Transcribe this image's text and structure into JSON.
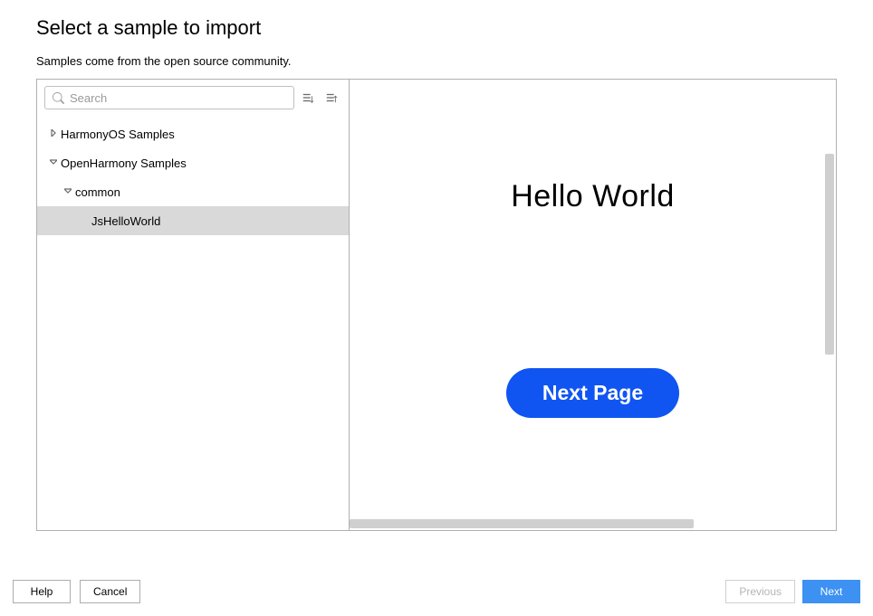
{
  "header": {
    "title": "Select a sample to import",
    "subtitle": "Samples come from the open source community."
  },
  "search": {
    "placeholder": "Search",
    "value": ""
  },
  "tree": {
    "items": [
      {
        "label": "HarmonyOS Samples",
        "level": 0,
        "expanded": false,
        "hasChildren": true,
        "selected": false
      },
      {
        "label": "OpenHarmony Samples",
        "level": 0,
        "expanded": true,
        "hasChildren": true,
        "selected": false
      },
      {
        "label": "common",
        "level": 1,
        "expanded": true,
        "hasChildren": true,
        "selected": false
      },
      {
        "label": "JsHelloWorld",
        "level": 2,
        "expanded": false,
        "hasChildren": false,
        "selected": true
      }
    ]
  },
  "preview": {
    "title": "Hello World",
    "button_label": "Next Page"
  },
  "footer": {
    "help": "Help",
    "cancel": "Cancel",
    "previous": "Previous",
    "next": "Next"
  }
}
